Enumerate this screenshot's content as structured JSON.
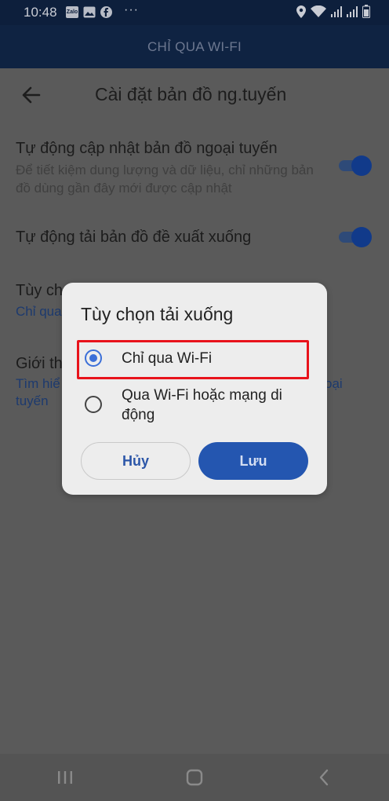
{
  "status_bar": {
    "time": "10:48",
    "app_badge": "Zalo",
    "more": "···"
  },
  "banner": {
    "text": "CHỈ QUA WI-FI"
  },
  "header": {
    "title": "Cài đặt bản đồ ng.tuyến"
  },
  "settings": {
    "auto_update": {
      "title": "Tự động cập nhật bản đồ ngoại tuyến",
      "desc": "Để tiết kiệm dung lượng và dữ liệu, chỉ những bản đồ dùng gần đây mới được cập nhật"
    },
    "auto_download": {
      "title": "Tự động tải bản đồ đề xuất xuống"
    },
    "download_pref": {
      "title_partial": "Tùy ch",
      "link_partial": "Chỉ qua"
    },
    "limit": {
      "title_partial": "Giới th",
      "link_left": "Tìm hiể",
      "link_right": "oại",
      "link_line2": "tuyến"
    }
  },
  "dialog": {
    "title": "Tùy chọn tải xuống",
    "options": [
      {
        "label": "Chỉ qua Wi-Fi",
        "selected": true
      },
      {
        "label": "Qua Wi-Fi hoặc mạng di động",
        "selected": false
      }
    ],
    "cancel_label": "Hủy",
    "save_label": "Lưu"
  },
  "colors": {
    "accent": "#2456b0",
    "highlight": "#e8131b",
    "radio": "#3b6fd8"
  }
}
